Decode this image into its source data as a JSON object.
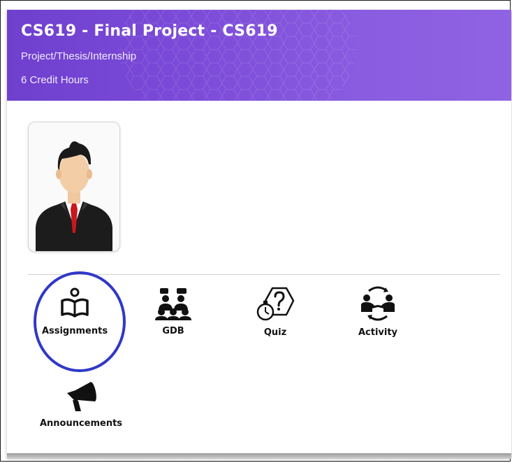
{
  "course": {
    "title": "CS619 - Final Project - CS619",
    "category": "Project/Thesis/Internship",
    "credits": "6 Credit Hours"
  },
  "tools": [
    {
      "label": "Assignments",
      "icon": "book-reader-icon"
    },
    {
      "label": "GDB",
      "icon": "discussion-group-icon"
    },
    {
      "label": "Quiz",
      "icon": "stopwatch-question-icon"
    },
    {
      "label": "Activity",
      "icon": "activity-exchange-icon"
    },
    {
      "label": "Announcements",
      "icon": "megaphone-icon"
    }
  ],
  "colors": {
    "banner": "#7b4ad8",
    "highlight_circle": "#3038c8"
  }
}
